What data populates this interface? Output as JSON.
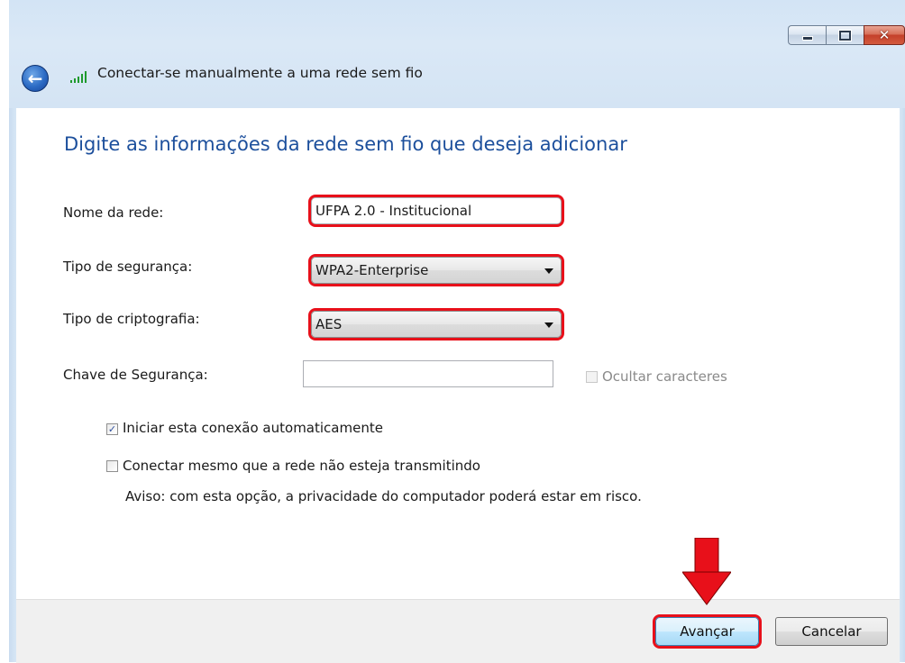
{
  "window": {
    "caption": {
      "minimize": "minimize-icon",
      "maximize": "maximize-icon",
      "close": "close-icon"
    }
  },
  "header": {
    "title": "Conectar-se manualmente a uma rede sem fio",
    "back_icon": "back-arrow-icon",
    "signal_icon": "wireless-signal-icon"
  },
  "main": {
    "heading": "Digite as informações da rede sem fio que deseja adicionar",
    "network_name": {
      "label": "Nome da rede:",
      "value": "UFPA 2.0 - Institucional"
    },
    "security_type": {
      "label": "Tipo de segurança:",
      "value": "WPA2-Enterprise"
    },
    "encryption_type": {
      "label": "Tipo de criptografia:",
      "value": "AES"
    },
    "security_key": {
      "label": "Chave de Segurança:",
      "value": "",
      "hide_chars_label": "Ocultar caracteres",
      "hide_chars_checked": false
    },
    "auto_start": {
      "label": "Iniciar esta conexão automaticamente",
      "checked": true
    },
    "connect_even": {
      "label": "Conectar mesmo que a rede não esteja transmitindo",
      "checked": false
    },
    "warning": "Aviso: com esta opção, a privacidade do computador poderá estar em risco."
  },
  "footer": {
    "next_label": "Avançar",
    "cancel_label": "Cancelar"
  },
  "colors": {
    "heading": "#1c4f9c",
    "highlight": "#e8101a",
    "annotation_arrow": "#e8101a"
  }
}
